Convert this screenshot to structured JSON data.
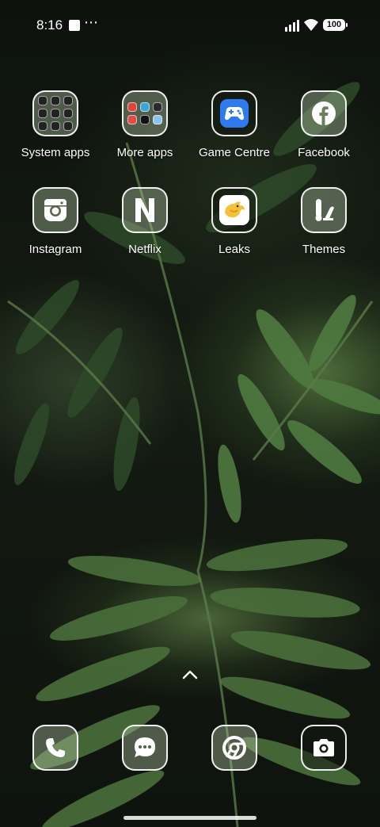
{
  "status_bar": {
    "time": "8:16",
    "more_indicator": "⋯",
    "battery": "100",
    "icons": [
      "notification-square-icon",
      "signal-icon",
      "wifi-icon",
      "battery-icon"
    ]
  },
  "home_grid": [
    {
      "label": "System apps",
      "icon": "folder-icon"
    },
    {
      "label": "More apps",
      "icon": "folder-icon"
    },
    {
      "label": "Game Centre",
      "icon": "gamepad-icon"
    },
    {
      "label": "Facebook",
      "icon": "facebook-icon"
    },
    {
      "label": "Instagram",
      "icon": "instagram-icon"
    },
    {
      "label": "Netflix",
      "icon": "netflix-icon"
    },
    {
      "label": "Leaks",
      "icon": "bird-icon"
    },
    {
      "label": "Themes",
      "icon": "themes-icon"
    }
  ],
  "dock": [
    {
      "name": "phone",
      "icon": "phone-icon"
    },
    {
      "name": "messages",
      "icon": "message-icon"
    },
    {
      "name": "chrome",
      "icon": "chrome-icon"
    },
    {
      "name": "camera",
      "icon": "camera-icon"
    }
  ],
  "colors": {
    "icon_border": "#ffffff",
    "game_centre_blue": "#2e7bf0",
    "leaks_yellow": "#f3c13a"
  }
}
